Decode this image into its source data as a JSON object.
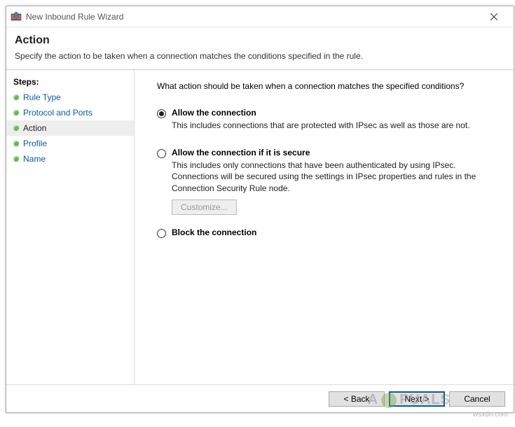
{
  "window": {
    "title": "New Inbound Rule Wizard"
  },
  "header": {
    "title": "Action",
    "subtitle": "Specify the action to be taken when a connection matches the conditions specified in the rule."
  },
  "steps": {
    "label": "Steps:",
    "items": [
      {
        "label": "Rule Type",
        "current": false
      },
      {
        "label": "Protocol and Ports",
        "current": false
      },
      {
        "label": "Action",
        "current": true
      },
      {
        "label": "Profile",
        "current": false
      },
      {
        "label": "Name",
        "current": false
      }
    ]
  },
  "content": {
    "question": "What action should be taken when a connection matches the specified conditions?",
    "options": [
      {
        "title": "Allow the connection",
        "desc": "This includes connections that are protected with IPsec as well as those are not.",
        "checked": true
      },
      {
        "title": "Allow the connection if it is secure",
        "desc": "This includes only connections that have been authenticated by using IPsec. Connections will be secured using the settings in IPsec properties and rules in the Connection Security Rule node.",
        "checked": false,
        "customize": "Customize..."
      },
      {
        "title": "Block the connection",
        "desc": "",
        "checked": false
      }
    ]
  },
  "footer": {
    "back": "< Back",
    "next": "Next >",
    "cancel": "Cancel"
  },
  "watermark": "A   PUALS",
  "credit": "wsxdn.com"
}
